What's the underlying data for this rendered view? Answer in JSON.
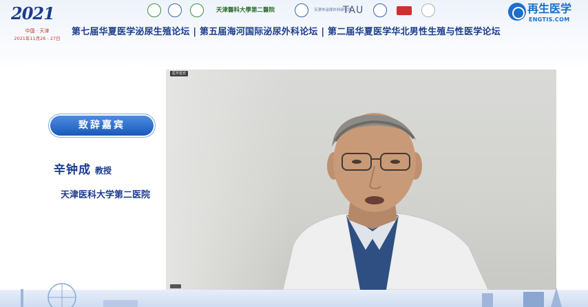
{
  "event": {
    "year_mark": "2021",
    "city": "中国 · 天津",
    "dates": "2021年11月26 - 27日"
  },
  "sponsors": {
    "hospital_name": "天津醫科大學第二醫院",
    "tau": "TAU",
    "small_caption": "天津市泌尿外科研究所"
  },
  "brand": {
    "name": "再生医学",
    "url": "ENGTIS.COM",
    "color": "#1e6fc6"
  },
  "forum_title": "第七届华夏医学泌尿生殖论坛 | 第五届海河国际泌尿外科论坛 | 第二届华夏医学华北男性生殖与性医学论坛",
  "speaker": {
    "role": "致辞嘉宾",
    "name": "辛钟成",
    "title": "教授",
    "affiliation": "天津医科大学第二医院"
  },
  "video": {
    "participant_tag": "医学嘉宾"
  },
  "colors": {
    "primary_navy": "#1c3c8c",
    "badge_blue": "#1b58ba",
    "accent_red": "#d02a2a"
  }
}
